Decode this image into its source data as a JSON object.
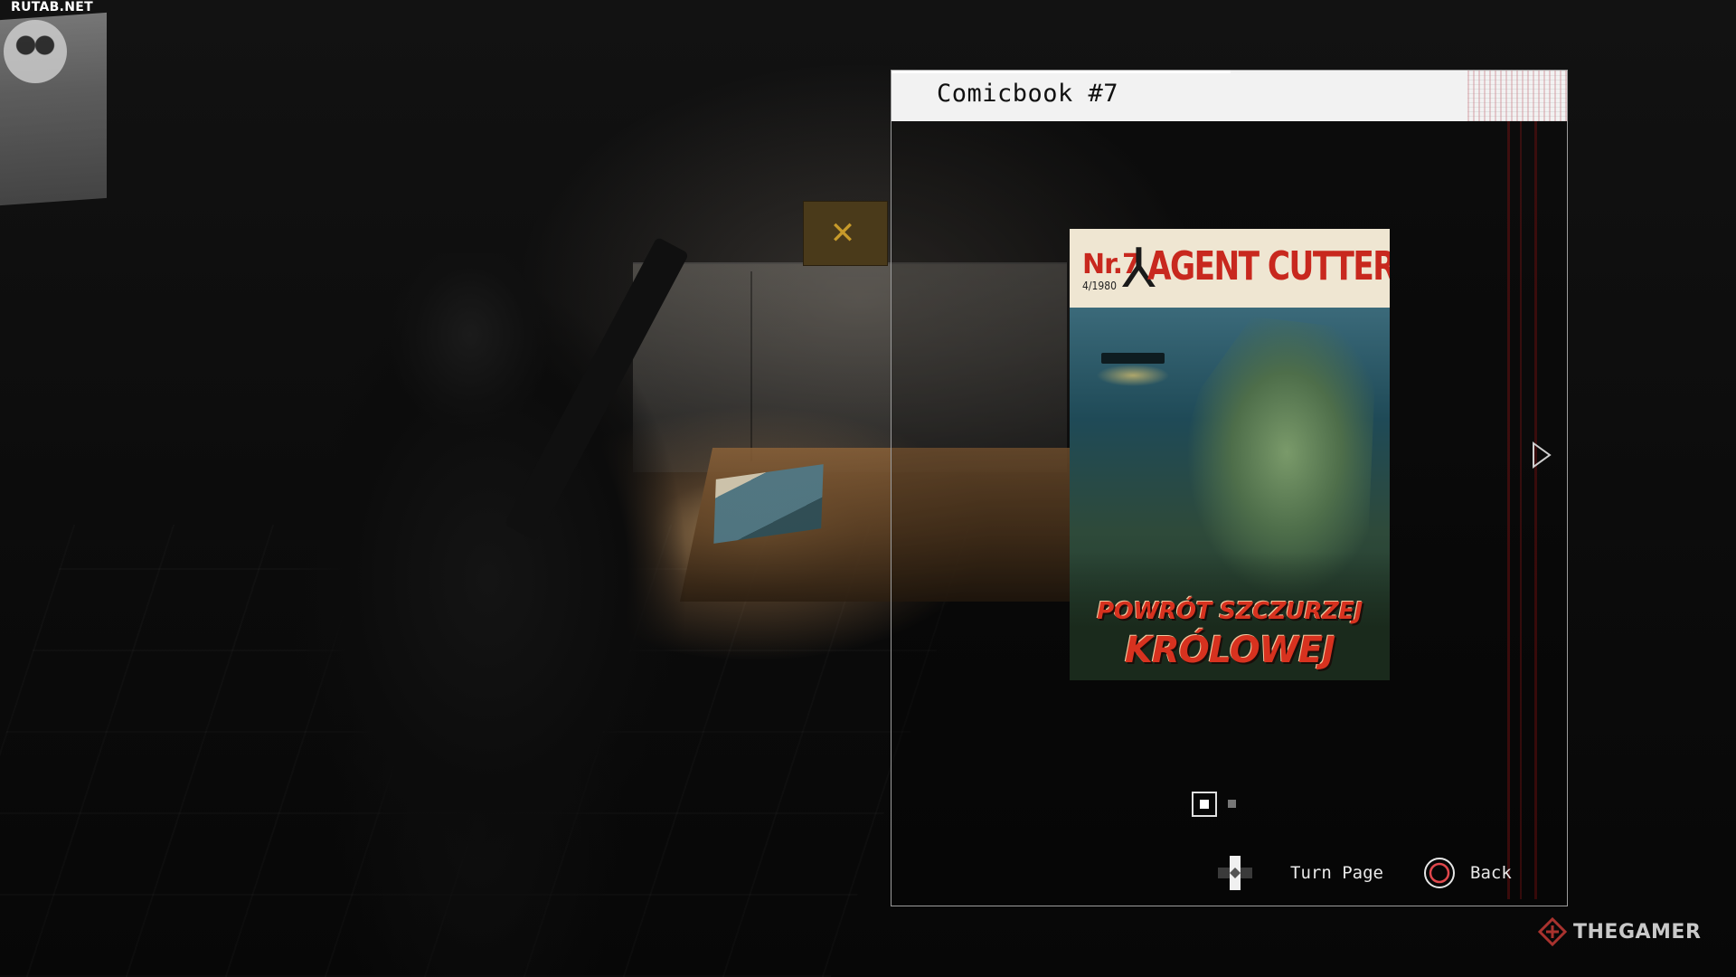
{
  "watermarks": {
    "top_left": "RUTAB.NET",
    "bottom_right": "THEGAMER"
  },
  "panel": {
    "title": "Comicbook #7"
  },
  "comic_cover": {
    "issue_number": "Nr.7",
    "issue_date": "4/1980",
    "series_title": "AGENT CUTTERS",
    "subtitle_line1": "POWRÓT SZCZURZEJ",
    "subtitle_line2": "KRÓLOWEJ"
  },
  "pagination": {
    "current_page": 1,
    "total_pages": 2
  },
  "prompts": {
    "turn_page": "Turn Page",
    "back": "Back"
  },
  "icons": {
    "next_page": "triangle-right-icon",
    "turn_page": "dpad-icon",
    "back": "circle-button-icon",
    "brand": "thegamer-logo-icon"
  },
  "colors": {
    "accent_red": "#c8281e",
    "panel_header": "#f2f2f2",
    "text": "#e9e9e9"
  }
}
